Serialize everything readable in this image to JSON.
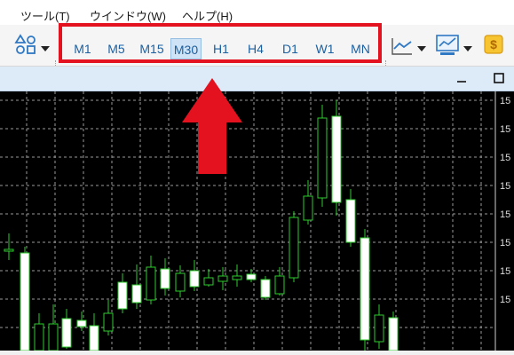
{
  "menu": {
    "items": [
      {
        "label": "ツール(T)"
      },
      {
        "label": "ウインドウ(W)"
      },
      {
        "label": "ヘルプ(H)"
      }
    ]
  },
  "toolbar": {
    "timeframes": [
      {
        "label": "M1",
        "active": false
      },
      {
        "label": "M5",
        "active": false
      },
      {
        "label": "M15",
        "active": false
      },
      {
        "label": "M30",
        "active": true
      },
      {
        "label": "H1",
        "active": false
      },
      {
        "label": "H4",
        "active": false
      },
      {
        "label": "D1",
        "active": false
      },
      {
        "label": "W1",
        "active": false
      },
      {
        "label": "MN",
        "active": false
      }
    ],
    "icons": [
      "objects-icon",
      "dropdown-arrow-icon",
      "line-chart-icon",
      "dropdown-arrow-icon",
      "indicators-icon",
      "dropdown-arrow-icon",
      "dollar-icon"
    ]
  },
  "chart_window": {
    "buttons": [
      "minimize-icon",
      "maximize-icon"
    ],
    "price_axis_label": "15",
    "price_label_count": 8
  },
  "annotation": {
    "box_color": "#e3121e",
    "arrow_color": "#e3121e",
    "arrow_direction": "up"
  },
  "colors": {
    "chart_background": "#000000",
    "grid": "#9a9a9a",
    "candle_bull_body": "#ffffff",
    "candle_wick": "#2ecc2e",
    "active_timeframe_bg": "#cfe3f6",
    "timeframe_text": "#1c5f9e"
  }
}
